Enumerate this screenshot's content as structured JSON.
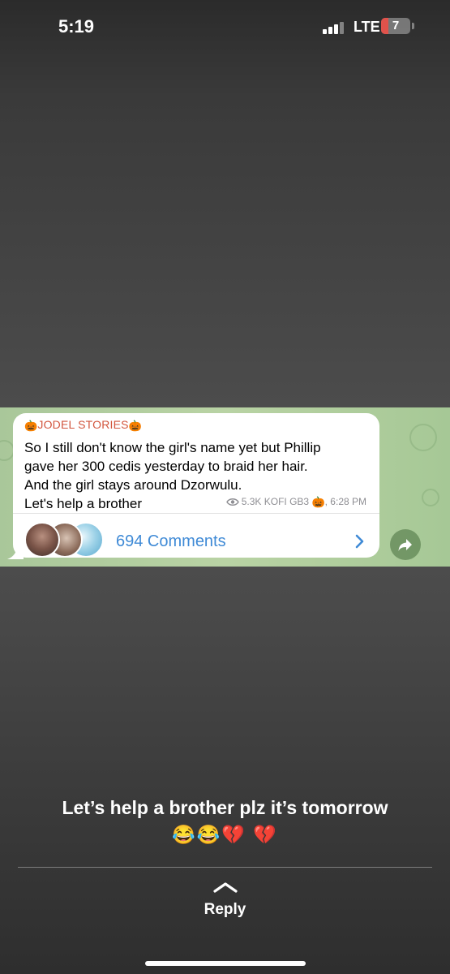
{
  "status_bar": {
    "time": "5:19",
    "network": "LTE",
    "battery_level": "7",
    "battery_color": "#e0524b"
  },
  "post": {
    "channel": "JODEL STORIES",
    "channel_icon": "pumpkin-icon",
    "lines": [
      "So I still don't know the girl's name yet but Phillip",
      "gave her 300 cedis yesterday to braid her hair.",
      "And the girl stays around Dzorwulu.",
      "Let's help a brother"
    ],
    "views": "5.3K",
    "author": "KOFI GB3",
    "time": ", 6:28 PM",
    "comments_label": "694 Comments",
    "link_color": "#3f8ad6"
  },
  "story": {
    "caption": "Let’s help a brother plz it’s tomorrow",
    "caption_emojis": "😂😂💔 💔",
    "reply_label": "Reply"
  }
}
